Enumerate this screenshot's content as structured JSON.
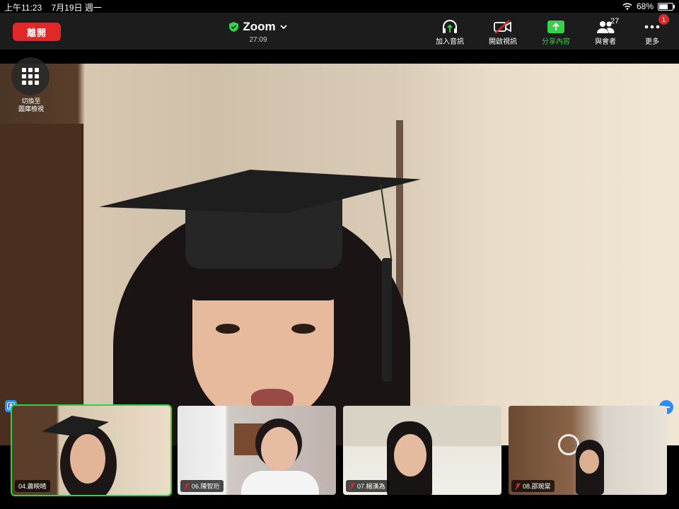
{
  "status_bar": {
    "time": "上午11:23",
    "date": "7月19日 週一",
    "battery": "68%",
    "battery_level": 0.68
  },
  "topbar": {
    "leave_label": "離開",
    "title": "Zoom",
    "timer": "27:09",
    "tools": [
      {
        "label": "加入音訊",
        "icon": "headphones-icon"
      },
      {
        "label": "開啟視訊",
        "icon": "video-off-icon"
      },
      {
        "label": "分享內容",
        "icon": "share-screen-icon"
      },
      {
        "label": "與會者",
        "icon": "participants-icon",
        "count": "27"
      },
      {
        "label": "更多",
        "icon": "more-icon",
        "badge": "1"
      }
    ]
  },
  "gallery_toggle": {
    "label_line1": "切換至",
    "label_line2": "圖庫檢視"
  },
  "thumbnails": [
    {
      "name": "04.蕭映晴",
      "muted": false,
      "active": true
    },
    {
      "name": "06.陳智珩",
      "muted": true,
      "active": false
    },
    {
      "name": "07.楊漢為",
      "muted": true,
      "active": false
    },
    {
      "name": "08.邵琬棠",
      "muted": true,
      "active": false
    }
  ],
  "colors": {
    "leave": "#e02828",
    "share": "#36d04a",
    "active_border": "#2fd23f",
    "accent": "#2d8cff"
  }
}
